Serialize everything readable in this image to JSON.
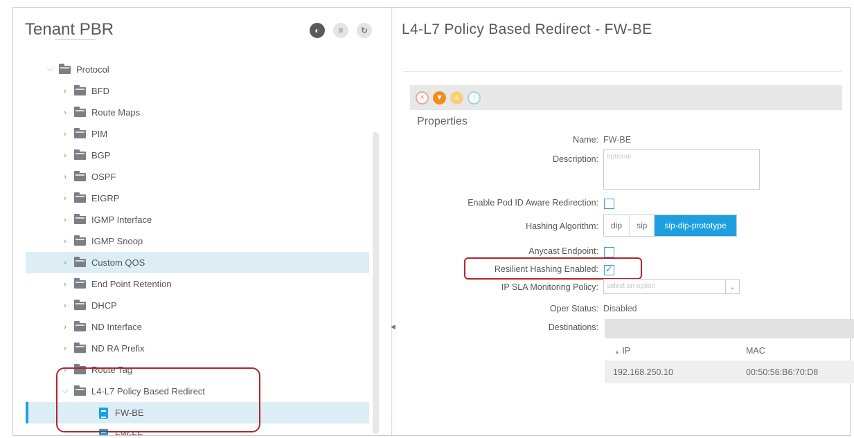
{
  "left": {
    "title": "Tenant PBR",
    "header_icons": [
      {
        "name": "policy-icon",
        "glyph": "◐"
      },
      {
        "name": "tools-icon",
        "glyph": "≡"
      },
      {
        "name": "refresh-icon",
        "glyph": "↻"
      }
    ],
    "tree": [
      {
        "label": "Protocol",
        "expanded": true,
        "indent": 1
      },
      {
        "label": "BFD",
        "indent": 2
      },
      {
        "label": "Route Maps",
        "indent": 2
      },
      {
        "label": "PIM",
        "indent": 2
      },
      {
        "label": "BGP",
        "indent": 2
      },
      {
        "label": "OSPF",
        "indent": 2
      },
      {
        "label": "EIGRP",
        "indent": 2
      },
      {
        "label": "IGMP Interface",
        "indent": 2
      },
      {
        "label": "IGMP Snoop",
        "indent": 2
      },
      {
        "label": "Custom QOS",
        "indent": 2,
        "highlight": true
      },
      {
        "label": "End Point Retention",
        "indent": 2
      },
      {
        "label": "DHCP",
        "indent": 2
      },
      {
        "label": "ND Interface",
        "indent": 2
      },
      {
        "label": "ND RA Prefix",
        "indent": 2
      },
      {
        "label": "Route Tag",
        "indent": 2
      },
      {
        "label": "L4-L7 Policy Based Redirect",
        "expanded": true,
        "indent": 2
      },
      {
        "label": "FW-BE",
        "leaf": true,
        "indent": 3,
        "selected": true
      },
      {
        "label": "FW-FE",
        "leaf": true,
        "indent": 3
      }
    ]
  },
  "right": {
    "title": "L4-L7 Policy Based Redirect - FW-BE",
    "section": "Properties",
    "fields": {
      "name_label": "Name:",
      "name_value": "FW-BE",
      "description_label": "Description:",
      "description_placeholder": "optional",
      "pod_label": "Enable Pod ID Aware Redirection:",
      "hashing_label": "Hashing Algorithm:",
      "hashing_options": [
        "dip",
        "sip",
        "sip-dip-prototype"
      ],
      "hashing_selected": "sip-dip-prototype",
      "anycast_label": "Anycast Endpoint:",
      "resilient_label": "Resilient Hashing Enabled:",
      "resilient_checked": true,
      "ipsla_label": "IP SLA Monitoring Policy:",
      "ipsla_placeholder": "select an option",
      "oper_label": "Oper Status:",
      "oper_value": "Disabled",
      "dest_label": "Destinations:"
    },
    "destinations": {
      "col_ip": "IP",
      "col_mac": "MAC",
      "rows": [
        {
          "ip": "192.168.250.10",
          "mac": "00:50:56:B6:70:D8"
        }
      ]
    }
  },
  "colors": {
    "accent": "#1ea0e0",
    "highlight_row": "#dcedf6",
    "callout_red": "#b0262c"
  }
}
